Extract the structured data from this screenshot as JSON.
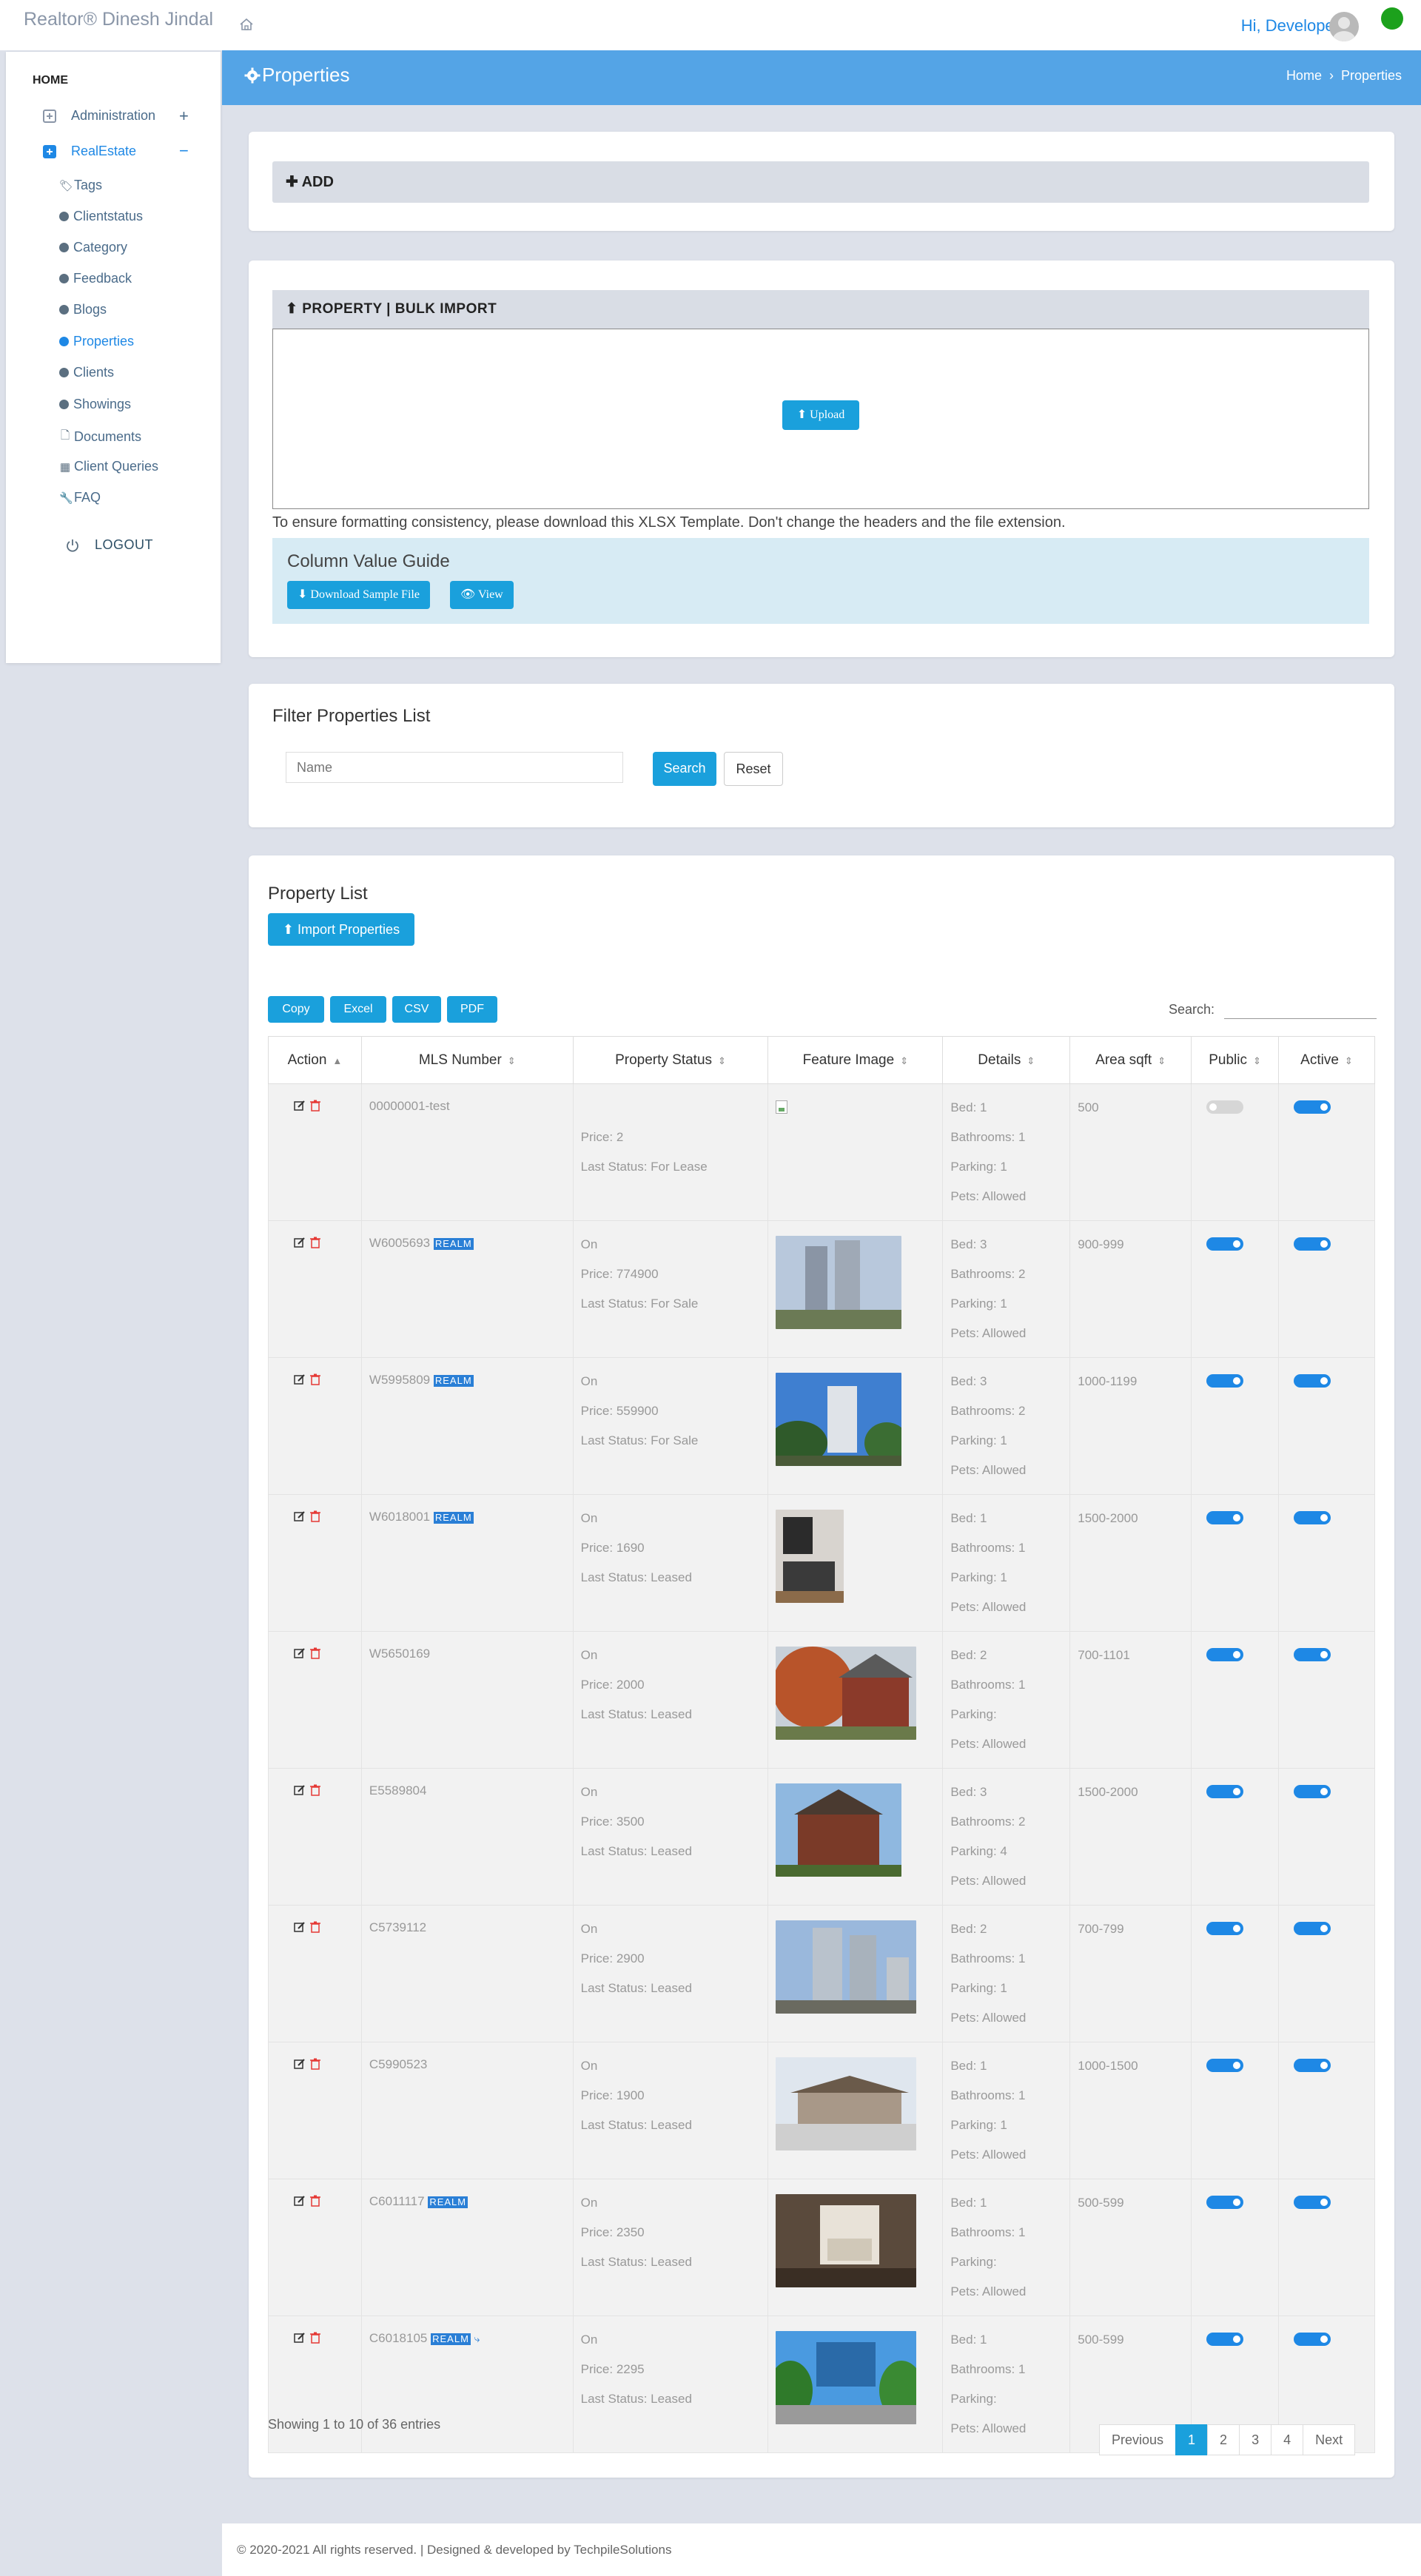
{
  "app": {
    "brand": "Realtor® Dinesh Jindal",
    "greeting": "Hi, Developer"
  },
  "sidebar": {
    "home": "HOME",
    "groups": [
      {
        "label": "Administration",
        "expanded": false
      },
      {
        "label": "RealEstate",
        "expanded": true
      }
    ],
    "items": [
      {
        "label": "Tags",
        "icon": "tag-icon"
      },
      {
        "label": "Clientstatus",
        "icon": "dot-icon"
      },
      {
        "label": "Category",
        "icon": "dot-icon"
      },
      {
        "label": "Feedback",
        "icon": "dot-icon"
      },
      {
        "label": "Blogs",
        "icon": "dot-icon"
      },
      {
        "label": "Properties",
        "icon": "dot-icon",
        "active": true
      },
      {
        "label": "Clients",
        "icon": "dot-icon"
      },
      {
        "label": "Showings",
        "icon": "dot-icon"
      },
      {
        "label": "Documents",
        "icon": "document-icon"
      },
      {
        "label": "Client Queries",
        "icon": "building-icon"
      },
      {
        "label": "FAQ",
        "icon": "wrench-icon"
      }
    ],
    "logout": "LOGOUT"
  },
  "header": {
    "title": "Properties",
    "breadcrumb": [
      "Home",
      "Properties"
    ]
  },
  "add_panel": {
    "label": "ADD"
  },
  "bulk_import": {
    "title": "PROPERTY | BULK IMPORT",
    "upload": "Upload",
    "note": "To ensure formatting consistency, please download this XLSX Template. Don't change the headers and the file extension.",
    "guide_title": "Column Value Guide",
    "download_label": "Download Sample File",
    "view_label": "View"
  },
  "filter": {
    "title": "Filter Properties List",
    "name_placeholder": "Name",
    "search": "Search",
    "reset": "Reset"
  },
  "property_list": {
    "title": "Property List",
    "import_label": "Import Properties",
    "exports": [
      "Copy",
      "Excel",
      "CSV",
      "PDF"
    ],
    "search_label": "Search:",
    "columns": [
      "Action",
      "MLS Number",
      "Property Status",
      "Feature Image",
      "Details",
      "Area sqft",
      "Public",
      "Active"
    ],
    "rows": [
      {
        "mls": "00000001-test",
        "realm": "",
        "status": "",
        "price": "Price: 2",
        "last": "Last Status: For Lease",
        "bed": "Bed: 1",
        "bath": "Bathrooms: 1",
        "park": "Parking: 1",
        "pets": "Pets: Allowed",
        "area": "500",
        "public": false,
        "active": true,
        "image": "broken-image"
      },
      {
        "mls": "W6005693",
        "realm": "REALM",
        "status": "On",
        "price": "Price: 774900",
        "last": "Last Status: For Sale",
        "bed": "Bed: 3",
        "bath": "Bathrooms: 2",
        "park": "Parking: 1",
        "pets": "Pets: Allowed",
        "area": "900-999",
        "public": true,
        "active": true,
        "image": "condo-towers-photo"
      },
      {
        "mls": "W5995809",
        "realm": "REALM",
        "status": "On",
        "price": "Price: 559900",
        "last": "Last Status: For Sale",
        "bed": "Bed: 3",
        "bath": "Bathrooms: 2",
        "park": "Parking: 1",
        "pets": "Pets: Allowed",
        "area": "1000-1199",
        "public": true,
        "active": true,
        "image": "highrise-trees-photo"
      },
      {
        "mls": "W6018001",
        "realm": "REALM",
        "status": "On",
        "price": "Price: 1690",
        "last": "Last Status: Leased",
        "bed": "Bed: 1",
        "bath": "Bathrooms: 1",
        "park": "Parking: 1",
        "pets": "Pets: Allowed",
        "area": "1500-2000",
        "public": true,
        "active": true,
        "image": "kitchen-photo"
      },
      {
        "mls": "W5650169",
        "realm": "",
        "status": "On",
        "price": "Price: 2000",
        "last": "Last Status: Leased",
        "bed": "Bed: 2",
        "bath": "Bathrooms: 1",
        "park": "Parking:",
        "pets": "Pets: Allowed",
        "area": "700-1101",
        "public": true,
        "active": true,
        "image": "autumn-house-photo"
      },
      {
        "mls": "E5589804",
        "realm": "",
        "status": "On",
        "price": "Price: 3500",
        "last": "Last Status: Leased",
        "bed": "Bed: 3",
        "bath": "Bathrooms: 2",
        "park": "Parking: 4",
        "pets": "Pets: Allowed",
        "area": "1500-2000",
        "public": true,
        "active": true,
        "image": "brick-house-photo"
      },
      {
        "mls": "C5739112",
        "realm": "",
        "status": "On",
        "price": "Price: 2900",
        "last": "Last Status: Leased",
        "bed": "Bed: 2",
        "bath": "Bathrooms: 1",
        "park": "Parking: 1",
        "pets": "Pets: Allowed",
        "area": "700-799",
        "public": true,
        "active": true,
        "image": "twin-towers-photo"
      },
      {
        "mls": "C5990523",
        "realm": "",
        "status": "On",
        "price": "Price: 1900",
        "last": "Last Status: Leased",
        "bed": "Bed: 1",
        "bath": "Bathrooms: 1",
        "park": "Parking: 1",
        "pets": "Pets: Allowed",
        "area": "1000-1500",
        "public": true,
        "active": true,
        "image": "bungalow-photo"
      },
      {
        "mls": "C6011117",
        "realm": "REALM",
        "status": "On",
        "price": "Price: 2350",
        "last": "Last Status: Leased",
        "bed": "Bed: 1",
        "bath": "Bathrooms: 1",
        "park": "Parking:",
        "pets": "Pets: Allowed",
        "area": "500-599",
        "public": true,
        "active": true,
        "image": "interior-photo"
      },
      {
        "mls": "C6018105",
        "realm": "REALM",
        "status": "On",
        "price": "Price: 2295",
        "last": "Last Status: Leased",
        "bed": "Bed: 1",
        "bath": "Bathrooms: 1",
        "park": "Parking:",
        "pets": "Pets: Allowed",
        "area": "500-599",
        "public": true,
        "active": true,
        "image": "glass-building-photo"
      }
    ],
    "showing": "Showing 1 to 10 of 36 entries",
    "pagination": [
      "Previous",
      "1",
      "2",
      "3",
      "4",
      "Next"
    ]
  },
  "footer": {
    "text": "© 2020-2021 All rights reserved. | Designed & developed by TechpileSolutions"
  },
  "colors": {
    "accent": "#1aa0dc",
    "header": "#54a4e6",
    "toggle_on": "#1e88e5",
    "online": "#1ca11c"
  }
}
